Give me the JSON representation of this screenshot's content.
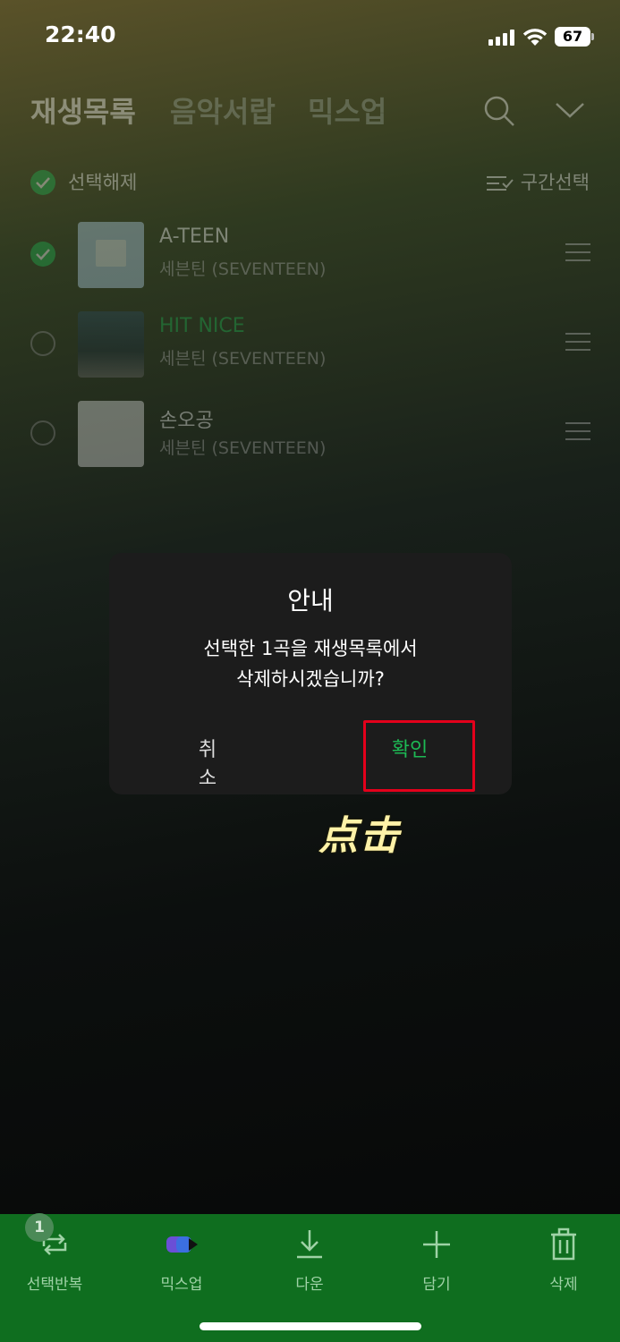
{
  "status_bar": {
    "time": "22:40",
    "battery": "67"
  },
  "header": {
    "tabs": [
      {
        "label": "재생목록"
      },
      {
        "label": "음악서랍"
      },
      {
        "label": "믹스업"
      }
    ]
  },
  "selection": {
    "deselect_label": "선택해제",
    "range_select_label": "구간선택"
  },
  "tracks": [
    {
      "title": "A-TEEN",
      "artist": "세븐틴 (SEVENTEEN)",
      "selected": true,
      "playing": false
    },
    {
      "title": "HIT NICE",
      "artist": "세븐틴 (SEVENTEEN)",
      "selected": false,
      "playing": true
    },
    {
      "title": "손오공",
      "artist": "세븐틴 (SEVENTEEN)",
      "selected": false,
      "playing": false
    }
  ],
  "dialog": {
    "title": "안내",
    "message_line1": "선택한 1곡을 재생목록에서",
    "message_line2": "삭제하시겠습니까?",
    "cancel_label": "취소",
    "confirm_label": "확인"
  },
  "annotation": {
    "note": "点击"
  },
  "bottom_bar": {
    "badge_count": "1",
    "items": [
      {
        "label": "선택반복",
        "icon": "repeat-icon"
      },
      {
        "label": "믹스업",
        "icon": "mixup-icon"
      },
      {
        "label": "다운",
        "icon": "download-icon"
      },
      {
        "label": "담기",
        "icon": "add-icon"
      },
      {
        "label": "삭제",
        "icon": "trash-icon"
      }
    ]
  },
  "colors": {
    "accent": "#1db954",
    "bottom_bar": "#0f6e1f",
    "highlight": "#e3001b"
  }
}
